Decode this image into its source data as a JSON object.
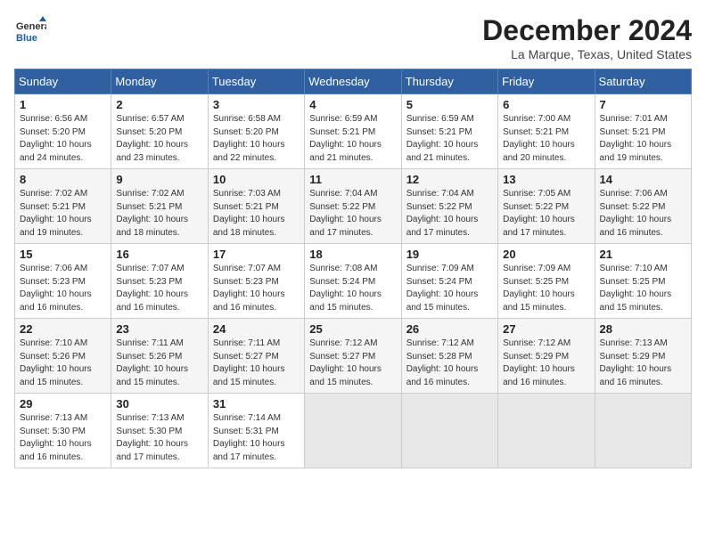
{
  "header": {
    "logo_line1": "General",
    "logo_line2": "Blue",
    "month": "December 2024",
    "location": "La Marque, Texas, United States"
  },
  "weekdays": [
    "Sunday",
    "Monday",
    "Tuesday",
    "Wednesday",
    "Thursday",
    "Friday",
    "Saturday"
  ],
  "weeks": [
    [
      {
        "day": "1",
        "info": "Sunrise: 6:56 AM\nSunset: 5:20 PM\nDaylight: 10 hours\nand 24 minutes."
      },
      {
        "day": "2",
        "info": "Sunrise: 6:57 AM\nSunset: 5:20 PM\nDaylight: 10 hours\nand 23 minutes."
      },
      {
        "day": "3",
        "info": "Sunrise: 6:58 AM\nSunset: 5:20 PM\nDaylight: 10 hours\nand 22 minutes."
      },
      {
        "day": "4",
        "info": "Sunrise: 6:59 AM\nSunset: 5:21 PM\nDaylight: 10 hours\nand 21 minutes."
      },
      {
        "day": "5",
        "info": "Sunrise: 6:59 AM\nSunset: 5:21 PM\nDaylight: 10 hours\nand 21 minutes."
      },
      {
        "day": "6",
        "info": "Sunrise: 7:00 AM\nSunset: 5:21 PM\nDaylight: 10 hours\nand 20 minutes."
      },
      {
        "day": "7",
        "info": "Sunrise: 7:01 AM\nSunset: 5:21 PM\nDaylight: 10 hours\nand 19 minutes."
      }
    ],
    [
      {
        "day": "8",
        "info": "Sunrise: 7:02 AM\nSunset: 5:21 PM\nDaylight: 10 hours\nand 19 minutes."
      },
      {
        "day": "9",
        "info": "Sunrise: 7:02 AM\nSunset: 5:21 PM\nDaylight: 10 hours\nand 18 minutes."
      },
      {
        "day": "10",
        "info": "Sunrise: 7:03 AM\nSunset: 5:21 PM\nDaylight: 10 hours\nand 18 minutes."
      },
      {
        "day": "11",
        "info": "Sunrise: 7:04 AM\nSunset: 5:22 PM\nDaylight: 10 hours\nand 17 minutes."
      },
      {
        "day": "12",
        "info": "Sunrise: 7:04 AM\nSunset: 5:22 PM\nDaylight: 10 hours\nand 17 minutes."
      },
      {
        "day": "13",
        "info": "Sunrise: 7:05 AM\nSunset: 5:22 PM\nDaylight: 10 hours\nand 17 minutes."
      },
      {
        "day": "14",
        "info": "Sunrise: 7:06 AM\nSunset: 5:22 PM\nDaylight: 10 hours\nand 16 minutes."
      }
    ],
    [
      {
        "day": "15",
        "info": "Sunrise: 7:06 AM\nSunset: 5:23 PM\nDaylight: 10 hours\nand 16 minutes."
      },
      {
        "day": "16",
        "info": "Sunrise: 7:07 AM\nSunset: 5:23 PM\nDaylight: 10 hours\nand 16 minutes."
      },
      {
        "day": "17",
        "info": "Sunrise: 7:07 AM\nSunset: 5:23 PM\nDaylight: 10 hours\nand 16 minutes."
      },
      {
        "day": "18",
        "info": "Sunrise: 7:08 AM\nSunset: 5:24 PM\nDaylight: 10 hours\nand 15 minutes."
      },
      {
        "day": "19",
        "info": "Sunrise: 7:09 AM\nSunset: 5:24 PM\nDaylight: 10 hours\nand 15 minutes."
      },
      {
        "day": "20",
        "info": "Sunrise: 7:09 AM\nSunset: 5:25 PM\nDaylight: 10 hours\nand 15 minutes."
      },
      {
        "day": "21",
        "info": "Sunrise: 7:10 AM\nSunset: 5:25 PM\nDaylight: 10 hours\nand 15 minutes."
      }
    ],
    [
      {
        "day": "22",
        "info": "Sunrise: 7:10 AM\nSunset: 5:26 PM\nDaylight: 10 hours\nand 15 minutes."
      },
      {
        "day": "23",
        "info": "Sunrise: 7:11 AM\nSunset: 5:26 PM\nDaylight: 10 hours\nand 15 minutes."
      },
      {
        "day": "24",
        "info": "Sunrise: 7:11 AM\nSunset: 5:27 PM\nDaylight: 10 hours\nand 15 minutes."
      },
      {
        "day": "25",
        "info": "Sunrise: 7:12 AM\nSunset: 5:27 PM\nDaylight: 10 hours\nand 15 minutes."
      },
      {
        "day": "26",
        "info": "Sunrise: 7:12 AM\nSunset: 5:28 PM\nDaylight: 10 hours\nand 16 minutes."
      },
      {
        "day": "27",
        "info": "Sunrise: 7:12 AM\nSunset: 5:29 PM\nDaylight: 10 hours\nand 16 minutes."
      },
      {
        "day": "28",
        "info": "Sunrise: 7:13 AM\nSunset: 5:29 PM\nDaylight: 10 hours\nand 16 minutes."
      }
    ],
    [
      {
        "day": "29",
        "info": "Sunrise: 7:13 AM\nSunset: 5:30 PM\nDaylight: 10 hours\nand 16 minutes."
      },
      {
        "day": "30",
        "info": "Sunrise: 7:13 AM\nSunset: 5:30 PM\nDaylight: 10 hours\nand 17 minutes."
      },
      {
        "day": "31",
        "info": "Sunrise: 7:14 AM\nSunset: 5:31 PM\nDaylight: 10 hours\nand 17 minutes."
      },
      {
        "day": "",
        "info": ""
      },
      {
        "day": "",
        "info": ""
      },
      {
        "day": "",
        "info": ""
      },
      {
        "day": "",
        "info": ""
      }
    ]
  ]
}
